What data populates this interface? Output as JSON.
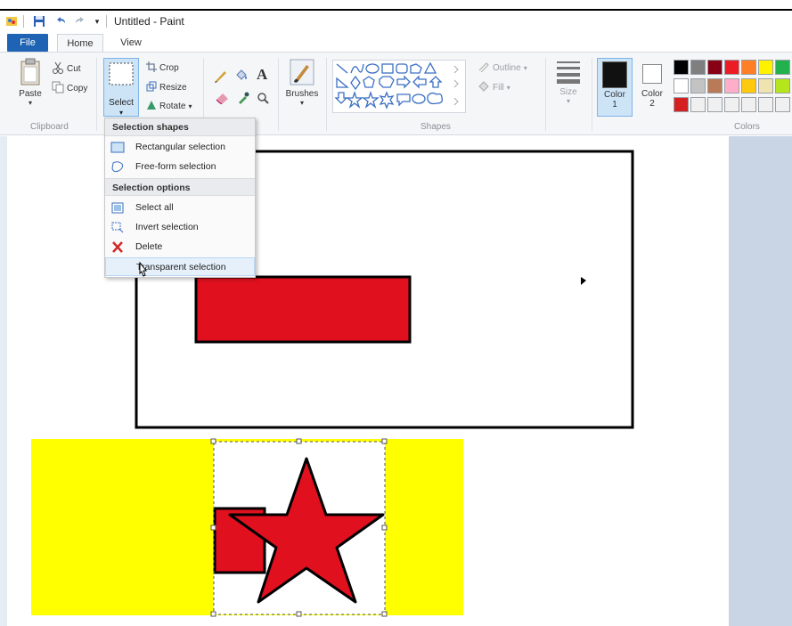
{
  "window": {
    "title": "Untitled - Paint"
  },
  "tabs": {
    "file": "File",
    "home": "Home",
    "view": "View"
  },
  "clipboard": {
    "paste": "Paste",
    "cut": "Cut",
    "copy": "Copy",
    "label": "Clipboard"
  },
  "image": {
    "select": "Select",
    "crop": "Crop",
    "resize": "Resize",
    "rotate": "Rotate"
  },
  "tools": {
    "text_tool": "A"
  },
  "brushes": {
    "label": "Brushes"
  },
  "shapes": {
    "label": "Shapes",
    "outline": "Outline",
    "fill": "Fill"
  },
  "size": {
    "label": "Size"
  },
  "colors": {
    "label": "Colors",
    "color1": "Color",
    "color1_num": "1",
    "color2": "Color",
    "color2_num": "2",
    "color1_value": "#111111",
    "color2_value": "#ffffff",
    "palette_row1": [
      "#000000",
      "#7f7f7f",
      "#880015",
      "#ed1c24",
      "#ff7f27",
      "#fff200",
      "#22b14c"
    ],
    "palette_row2": [
      "#ffffff",
      "#c3c3c3",
      "#b97a57",
      "#ffaec9",
      "#ffc90e",
      "#efe4b0",
      "#b5e61d"
    ],
    "palette_row3": [
      "#d42020",
      "#f0f0f0",
      "#f0f0f0",
      "#f0f0f0",
      "#f0f0f0",
      "#f0f0f0",
      "#f0f0f0"
    ]
  },
  "select_menu": {
    "shapes_header": "Selection shapes",
    "rectangular": "Rectangular selection",
    "freeform": "Free-form selection",
    "options_header": "Selection options",
    "select_all": "Select all",
    "invert": "Invert selection",
    "delete": "Delete",
    "transparent": "Transparent selection"
  },
  "drawing": {
    "frame_color": "#000000",
    "rect_fill": "#e0101f",
    "yellow": "#ffff00",
    "star_fill": "#e0101f"
  }
}
